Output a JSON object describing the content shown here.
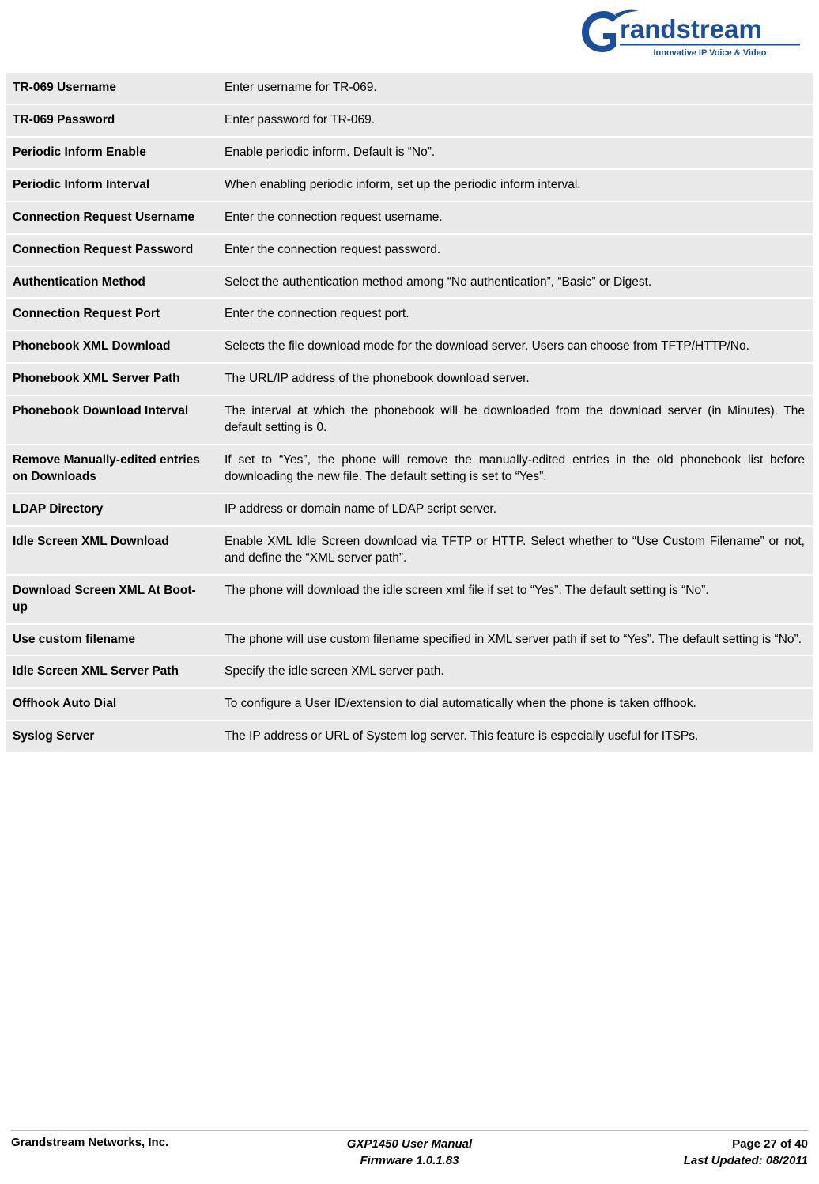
{
  "brand": {
    "name": "randstream",
    "initial": "G",
    "tagline": "Innovative IP Voice & Video",
    "accent_color": "#1b4f9c",
    "logo_icon": "grandstream-logo"
  },
  "table": {
    "rows": [
      {
        "label": "TR-069 Username",
        "desc": "Enter username for TR-069."
      },
      {
        "label": "TR-069 Password",
        "desc": "Enter password for TR-069."
      },
      {
        "label": "Periodic Inform Enable",
        "desc": "Enable periodic inform. Default is “No”."
      },
      {
        "label": "Periodic Inform Interval",
        "desc": "When enabling periodic inform, set up the periodic inform interval."
      },
      {
        "label": "Connection Request Username",
        "desc": "Enter the connection request username."
      },
      {
        "label": "Connection Request Password",
        "desc": "Enter the connection request password."
      },
      {
        "label": "Authentication Method",
        "desc": "Select the authentication method among “No authentication”, “Basic” or Digest."
      },
      {
        "label": "Connection Request Port",
        "desc": "Enter the connection request port."
      },
      {
        "label": "Phonebook XML Download",
        "desc": "Selects the file download mode for the download server. Users can choose from TFTP/HTTP/No."
      },
      {
        "label": "Phonebook XML Server Path",
        "desc": "The URL/IP address of the phonebook download server."
      },
      {
        "label": "Phonebook Download Interval",
        "desc": "The interval at which the phonebook will be downloaded from the download server (in Minutes). The default setting is 0."
      },
      {
        "label": "Remove Manually-edited entries on Downloads",
        "desc": "If set to “Yes”, the phone will remove the manually-edited entries in the old phonebook list before downloading the new file. The default setting is set to “Yes”."
      },
      {
        "label": "LDAP Directory",
        "desc": "IP address or domain name of LDAP script server."
      },
      {
        "label": "Idle Screen XML Download",
        "desc": "Enable XML Idle Screen download via TFTP or HTTP. Select whether to “Use Custom Filename” or not, and define the “XML server path”."
      },
      {
        "label": "Download Screen XML At Boot-up",
        "desc": "The phone will download the idle screen xml file if set to “Yes”. The default setting is “No”."
      },
      {
        "label": "Use custom filename",
        "desc": "The phone will use custom filename specified in XML server path if set to “Yes”. The default setting is “No”."
      },
      {
        "label": "Idle Screen XML Server Path",
        "desc": "Specify the idle screen XML server path."
      },
      {
        "label": "Offhook Auto Dial",
        "desc": "To configure a User ID/extension to dial automatically when the phone is taken offhook."
      },
      {
        "label": "Syslog Server",
        "desc": "The IP address or URL of System log server. This feature is especially useful for ITSPs."
      }
    ]
  },
  "footer": {
    "company": "Grandstream Networks, Inc.",
    "manual_title": "GXP1450 User Manual",
    "firmware": "Firmware 1.0.1.83",
    "page": "Page 27 of 40",
    "last_updated": "Last Updated:  08/2011"
  }
}
